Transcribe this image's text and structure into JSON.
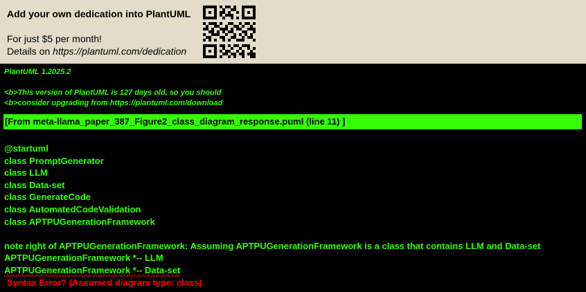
{
  "banner": {
    "title": "Add your own dedication into PlantUML",
    "line1": "For just $5 per month!",
    "line2_prefix": "Details on ",
    "line2_link": "https://plantuml.com/dedication",
    "qr_icon": "qr-code-icon"
  },
  "error": {
    "version": "PlantUML 1.2025.2",
    "warning_line1": "<b>This version of PlantUML is 127 days old, so you should",
    "warning_line2": "<b>consider upgrading from https://plantuml.com/download",
    "source": "[From meta-llama_paper_387_Figure2_class_diagram_response.puml (line 11) ]",
    "code_lines": [
      "@startuml",
      "class PromptGenerator",
      "class LLM",
      "class Data-set",
      "class GenerateCode",
      "class AutomatedCodeValidation",
      "class APTPUGenerationFramework",
      "",
      "note right of APTPUGenerationFramework: Assuming APTPUGenerationFramework is a class that contains LLM and Data-set",
      "APTPUGenerationFramework *-- LLM"
    ],
    "error_line": "APTPUGenerationFramework *-- Data-set",
    "syntax_error": "Syntax Error? (Assumed diagram type: class)"
  },
  "colors": {
    "banner_bg": "#e2dcc8",
    "background": "#000000",
    "text_green": "#33ff02",
    "error_red": "#ff0000"
  }
}
